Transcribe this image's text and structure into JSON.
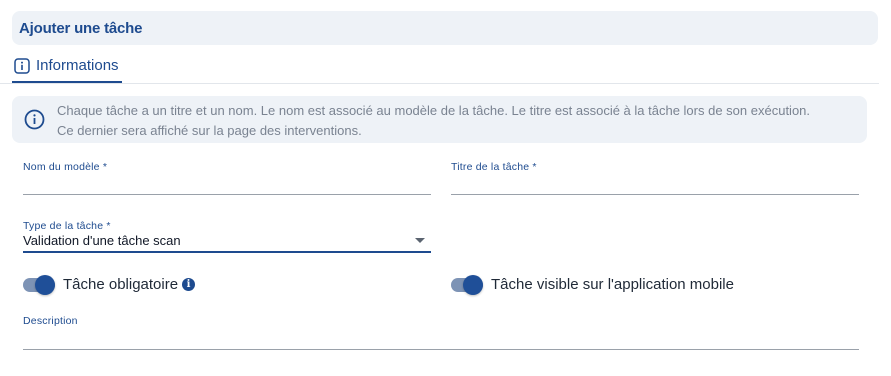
{
  "header": {
    "title": "Ajouter une tâche"
  },
  "tabs": [
    {
      "label": "Informations",
      "icon": "info-icon"
    }
  ],
  "info_box": {
    "icon": "info-circle-icon",
    "text": "Chaque tâche a un titre et un nom. Le nom est associé au modèle de la tâche. Le titre est associé à la tâche lors de son exécution. Ce dernier sera affiché sur la page des interventions."
  },
  "form": {
    "model_name": {
      "label": "Nom du modèle *",
      "value": ""
    },
    "task_title": {
      "label": "Titre de la tâche *",
      "value": ""
    },
    "task_type": {
      "label": "Type de la tâche *",
      "value": "Validation d'une tâche scan"
    },
    "mandatory_toggle": {
      "label": "Tâche obligatoire",
      "checked": true,
      "info_icon": "info-icon"
    },
    "mobile_toggle": {
      "label": "Tâche visible sur l'application mobile",
      "checked": true
    },
    "description": {
      "label": "Description",
      "value": ""
    }
  },
  "colors": {
    "accent": "#1e4b8f",
    "panel_bg": "#eef2f7",
    "toggle_track": "#7d93b5"
  }
}
